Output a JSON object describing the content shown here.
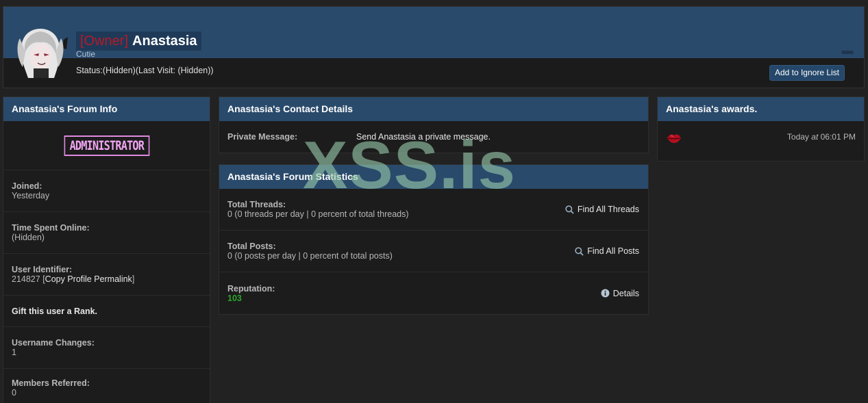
{
  "header": {
    "rank_tag": "[Owner]",
    "username": "Anastasia",
    "usertitle": "Cutie",
    "status": "Status:(Hidden)(Last Visit: (Hidden))",
    "ignore_button": "Add to Ignore List"
  },
  "forum_info": {
    "title": "Anastasia's Forum Info",
    "rank_badge": "ADMINISTRATOR",
    "joined_label": "Joined:",
    "joined_value": "Yesterday",
    "time_online_label": "Time Spent Online:",
    "time_online_value": "(Hidden)",
    "uid_label": "User Identifier:",
    "uid_value": "214827",
    "uid_link": "Copy Profile Permalink",
    "gift_rank": "Gift this user a Rank.",
    "username_changes_label": "Username Changes:",
    "username_changes_value": "1",
    "members_referred_label": "Members Referred:",
    "members_referred_value": "0"
  },
  "contact": {
    "title": "Anastasia's Contact Details",
    "pm_label": "Private Message:",
    "pm_link": "Send Anastasia a private message."
  },
  "stats": {
    "title": "Anastasia's Forum Statistics",
    "threads_label": "Total Threads:",
    "threads_value": "0 (0 threads per day | 0 percent of total threads)",
    "threads_action": "Find All Threads",
    "posts_label": "Total Posts:",
    "posts_value": "0 (0 posts per day | 0 percent of total posts)",
    "posts_action": "Find All Posts",
    "reputation_label": "Reputation:",
    "reputation_value": "103",
    "reputation_action": "Details"
  },
  "awards": {
    "title": "Anastasia's awards.",
    "time_prefix": "Today",
    "time_at": "at",
    "time_value": "06:01 PM"
  },
  "watermark": "XSS.is",
  "colors": {
    "panel_head": "#2a4a6b",
    "owner_tag": "#b51a2a",
    "reputation": "#2aa52a",
    "badge": "#e08be0"
  }
}
